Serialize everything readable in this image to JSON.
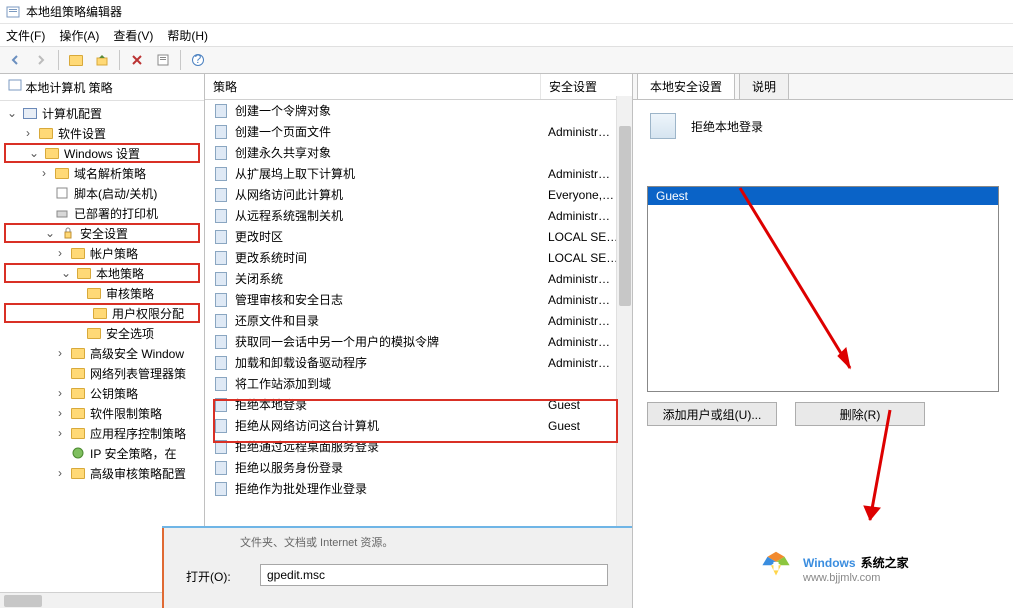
{
  "window": {
    "title": "本地组策略编辑器"
  },
  "menu": {
    "file": "文件(F)",
    "action": "操作(A)",
    "view": "查看(V)",
    "help": "帮助(H)"
  },
  "tree": {
    "root": "本地计算机 策略",
    "computer_config": "计算机配置",
    "software_settings": "软件设置",
    "windows_settings": "Windows 设置",
    "dns_policy": "域名解析策略",
    "scripts": "脚本(启动/关机)",
    "printers": "已部署的打印机",
    "security_settings": "安全设置",
    "account_policy": "帐户策略",
    "local_policy": "本地策略",
    "audit_policy": "审核策略",
    "user_rights": "用户权限分配",
    "security_options": "安全选项",
    "adv_fw": "高级安全 Window",
    "net_list": "网络列表管理器策",
    "public_key": "公钥策略",
    "sw_restrict": "软件限制策略",
    "app_ctrl": "应用程序控制策略",
    "ip_sec": "IP 安全策略，在",
    "adv_audit": "高级审核策略配置"
  },
  "cols": {
    "policy": "策略",
    "setting": "安全设置"
  },
  "policies": [
    {
      "name": "创建一个令牌对象",
      "value": ""
    },
    {
      "name": "创建一个页面文件",
      "value": "Administr…"
    },
    {
      "name": "创建永久共享对象",
      "value": ""
    },
    {
      "name": "从扩展坞上取下计算机",
      "value": "Administr…"
    },
    {
      "name": "从网络访问此计算机",
      "value": "Everyone,…"
    },
    {
      "name": "从远程系统强制关机",
      "value": "Administr…"
    },
    {
      "name": "更改时区",
      "value": "LOCAL SE…"
    },
    {
      "name": "更改系统时间",
      "value": "LOCAL SE…"
    },
    {
      "name": "关闭系统",
      "value": "Administr…"
    },
    {
      "name": "管理审核和安全日志",
      "value": "Administr…"
    },
    {
      "name": "还原文件和目录",
      "value": "Administr…"
    },
    {
      "name": "获取同一会话中另一个用户的模拟令牌",
      "value": "Administr…"
    },
    {
      "name": "加载和卸载设备驱动程序",
      "value": "Administr…"
    },
    {
      "name": "将工作站添加到域",
      "value": ""
    },
    {
      "name": "拒绝本地登录",
      "value": "Guest"
    },
    {
      "name": "拒绝从网络访问这台计算机",
      "value": "Guest"
    },
    {
      "name": "拒绝通过远程桌面服务登录",
      "value": ""
    },
    {
      "name": "拒绝以服务身份登录",
      "value": ""
    },
    {
      "name": "拒绝作为批处理作业登录",
      "value": ""
    }
  ],
  "detail": {
    "tab1": "本地安全设置",
    "tab2": "说明",
    "title": "拒绝本地登录",
    "selected_user": "Guest",
    "add_btn": "添加用户或组(U)...",
    "del_btn": "删除(R)"
  },
  "run": {
    "hint": "文件夹、文档或 Internet 资源。",
    "open_label": "打开(O):",
    "value": "gpedit.msc"
  },
  "brand": {
    "name": "Windows 系统之家",
    "url": "www.bjjmlv.com"
  }
}
